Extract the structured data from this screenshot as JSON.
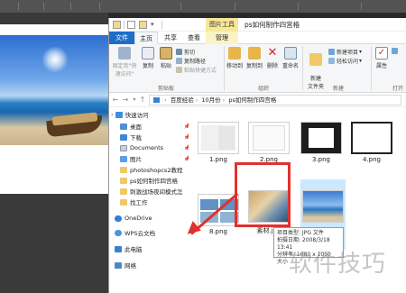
{
  "window": {
    "title": "ps如何制作四宫格",
    "context_tab_title": "图片工具"
  },
  "tabs": [
    "文件",
    "主页",
    "共享",
    "查看",
    "管理"
  ],
  "ribbon": {
    "clipboard": {
      "pin_label": "固定到\"快速访问\"",
      "copy_label": "复制",
      "paste_label": "粘贴",
      "cut_label": "剪切",
      "copy_path_label": "复制路径",
      "paste_shortcut_label": "粘贴快捷方式",
      "group_label": "剪贴板"
    },
    "organize": {
      "move_to_label": "移动到",
      "copy_to_label": "复制到",
      "delete_label": "删除",
      "rename_label": "重命名",
      "group_label": "组织"
    },
    "new": {
      "new_folder_label": "新建\n文件夹",
      "new_item_label": "新建项目",
      "easy_access_label": "轻松访问",
      "group_label": "新建"
    },
    "open": {
      "properties_label": "属性",
      "group_label": "打开"
    }
  },
  "address": {
    "path": [
      "百度经验",
      "10月份",
      "ps如何制作四宫格"
    ]
  },
  "nav": {
    "items": [
      {
        "label": "快速访问",
        "icon": "star-icon"
      },
      {
        "label": "桌面",
        "icon": "desktop-icon"
      },
      {
        "label": "下载",
        "icon": "download-icon"
      },
      {
        "label": "Documents",
        "icon": "documents-icon"
      },
      {
        "label": "图片",
        "icon": "pictures-icon"
      },
      {
        "label": "photoshopcs2教程",
        "icon": "folder-icon"
      },
      {
        "label": "ps如何制作四宫格",
        "icon": "folder-icon"
      },
      {
        "label": "刺激战场夜间模式怎",
        "icon": "folder-icon"
      },
      {
        "label": "找工作",
        "icon": "folder-icon"
      },
      {
        "label": "OneDrive",
        "icon": "onedrive-icon"
      },
      {
        "label": "WPS云文档",
        "icon": "wps-cloud-icon"
      },
      {
        "label": "此电脑",
        "icon": "pc-icon"
      },
      {
        "label": "网络",
        "icon": "network-icon"
      }
    ]
  },
  "files": [
    {
      "name": "1.png"
    },
    {
      "name": "2.png"
    },
    {
      "name": "3.png"
    },
    {
      "name": "4.png"
    },
    {
      "name": "8.png"
    },
    {
      "name": "素材.jpg"
    },
    {
      "name": ""
    }
  ],
  "tooltip": {
    "line1": "项目类型: JPG 文件",
    "line2": "拍摄日期: 2008/3/18 13:41",
    "line3": "分辨率: 1680 x 1050",
    "line4": "大小"
  },
  "watermark": "软件技巧",
  "colors": {
    "file_tab": "#1e6ec8",
    "selection": "#cce8ff",
    "highlight": "#e0312e",
    "context_tab": "#f7e79a"
  }
}
